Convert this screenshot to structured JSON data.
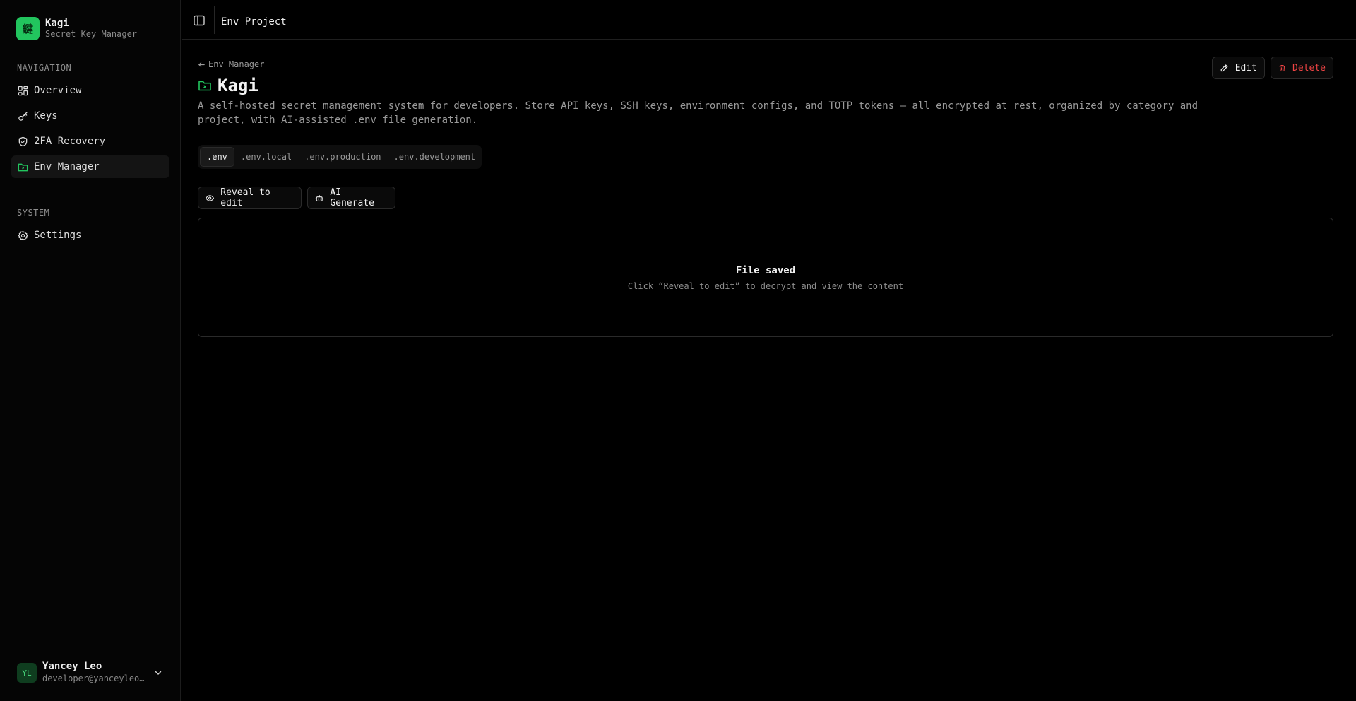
{
  "app": {
    "name": "Kagi",
    "subtitle": "Secret Key Manager",
    "logo_glyph": "鍵",
    "accent_color": "#22c55e"
  },
  "sidebar": {
    "nav_label": "NAVIGATION",
    "nav_items": [
      {
        "label": "Overview",
        "icon": "grid-icon"
      },
      {
        "label": "Keys",
        "icon": "key-icon"
      },
      {
        "label": "2FA Recovery",
        "icon": "shield-check-icon"
      },
      {
        "label": "Env Manager",
        "icon": "folder-icon",
        "active": true
      }
    ],
    "system_label": "SYSTEM",
    "system_items": [
      {
        "label": "Settings",
        "icon": "gear-icon"
      }
    ]
  },
  "user": {
    "initials": "YL",
    "name": "Yancey Leo",
    "email": "developer@yanceyleo.com"
  },
  "header": {
    "title": "Env Project"
  },
  "main": {
    "back_label": "Env Manager",
    "title": "Kagi",
    "description": "A self-hosted secret management system for developers. Store API keys, SSH keys, environment configs, and TOTP tokens — all encrypted at rest, organized by category and project, with AI-assisted .env file generation.",
    "edit_label": "Edit",
    "delete_label": "Delete",
    "tabs": [
      {
        "label": ".env",
        "active": true
      },
      {
        "label": ".env.local"
      },
      {
        "label": ".env.production"
      },
      {
        "label": ".env.development"
      }
    ],
    "reveal_label": "Reveal to edit",
    "ai_label": "AI Generate",
    "box_title": "File saved",
    "box_subtitle": "Click “Reveal to edit” to decrypt and view the content"
  },
  "colors": {
    "background": "#000000",
    "danger": "#ef4444",
    "accent": "#22c55e"
  }
}
